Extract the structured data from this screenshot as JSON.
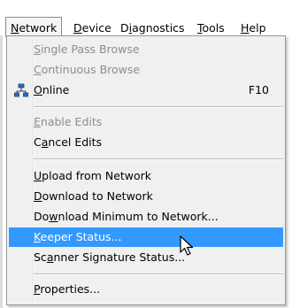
{
  "menubar": {
    "items": [
      {
        "pre": "",
        "u": "N",
        "post": "etwork",
        "active": true
      },
      {
        "pre": "",
        "u": "D",
        "post": "evice"
      },
      {
        "pre": "D",
        "u": "i",
        "post": "agnostics"
      },
      {
        "pre": "",
        "u": "T",
        "post": "ools"
      },
      {
        "pre": "",
        "u": "H",
        "post": "elp"
      }
    ]
  },
  "menu": {
    "single_pass": {
      "u": "S",
      "post": "ingle Pass Browse"
    },
    "continuous": {
      "u": "C",
      "post": "ontinuous Browse"
    },
    "online": {
      "u": "O",
      "post": "nline",
      "shortcut": "F10"
    },
    "enable_edits": {
      "u": "E",
      "post": "nable Edits"
    },
    "cancel_edits": {
      "pre": "C",
      "u": "a",
      "post": "ncel Edits"
    },
    "upload": {
      "u": "U",
      "post": "pload from Network"
    },
    "download": {
      "u": "D",
      "post": "ownload to Network"
    },
    "download_min": {
      "pre": "Do",
      "u": "w",
      "post": "nload Minimum to Network..."
    },
    "keeper": {
      "u": "K",
      "post": "eeper Status..."
    },
    "scanner": {
      "pre": "Sc",
      "u": "a",
      "post": "nner Signature Status..."
    },
    "properties": {
      "u": "P",
      "post": "roperties..."
    }
  },
  "icons": {
    "online": "network-icon",
    "cursor": "mouse-pointer-icon"
  },
  "colors": {
    "highlight": "#3399ff",
    "disabled_text": "#8d8d8d"
  }
}
